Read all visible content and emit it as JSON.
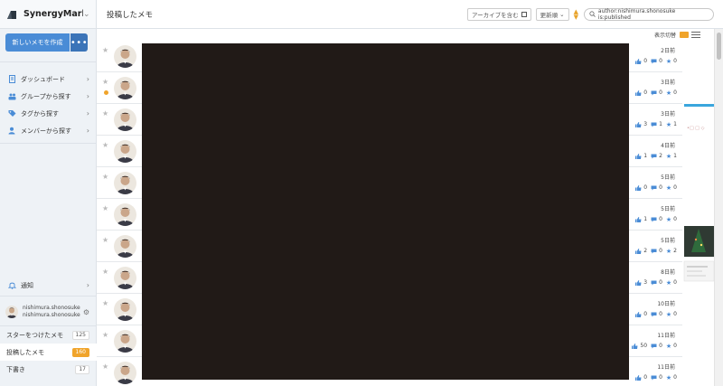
{
  "brand": {
    "name": "SynergyMark..."
  },
  "create": {
    "label": "新しいメモを作成",
    "more": "•••"
  },
  "nav": [
    {
      "label": "ダッシュボード",
      "icon": "document-icon"
    },
    {
      "label": "グループから探す",
      "icon": "group-icon"
    },
    {
      "label": "タグから探す",
      "icon": "tag-icon"
    },
    {
      "label": "メンバーから探す",
      "icon": "member-icon"
    }
  ],
  "notification": {
    "label": "通知"
  },
  "user": {
    "display_name": "nishimura.shonosuke",
    "username": "nishimura.shonosuke"
  },
  "stats": [
    {
      "label": "スターをつけたメモ",
      "count": "125"
    },
    {
      "label": "投稿したメモ",
      "count": "160"
    },
    {
      "label": "下書き",
      "count": "17"
    }
  ],
  "header": {
    "title": "投稿したメモ",
    "archive_label": "アーカイブを含む",
    "sort_label": "更新順",
    "search_value": "author:nishimura.shonosuke is:published"
  },
  "viewbar": {
    "label": "表示切替"
  },
  "colors": {
    "accent": "#f0a42b",
    "primary": "#4a8cd6",
    "dark": "#211a17"
  },
  "rows": [
    {
      "date": "2日前",
      "likes": "0",
      "comments": "0",
      "stars": "0",
      "unread": false
    },
    {
      "date": "3日前",
      "likes": "0",
      "comments": "0",
      "stars": "0",
      "unread": true
    },
    {
      "date": "3日前",
      "likes": "3",
      "comments": "1",
      "stars": "1",
      "unread": false
    },
    {
      "date": "4日前",
      "likes": "1",
      "comments": "2",
      "stars": "1",
      "unread": false
    },
    {
      "date": "5日前",
      "likes": "0",
      "comments": "0",
      "stars": "0",
      "unread": false
    },
    {
      "date": "5日前",
      "likes": "1",
      "comments": "0",
      "stars": "0",
      "unread": false
    },
    {
      "date": "5日前",
      "likes": "2",
      "comments": "0",
      "stars": "2",
      "unread": false
    },
    {
      "date": "8日前",
      "likes": "3",
      "comments": "0",
      "stars": "0",
      "unread": false
    },
    {
      "date": "10日前",
      "likes": "0",
      "comments": "0",
      "stars": "0",
      "unread": false
    },
    {
      "date": "11日前",
      "likes": "50",
      "comments": "0",
      "stars": "0",
      "unread": false
    },
    {
      "date": "11日前",
      "likes": "0",
      "comments": "0",
      "stars": "0",
      "unread": false
    }
  ]
}
